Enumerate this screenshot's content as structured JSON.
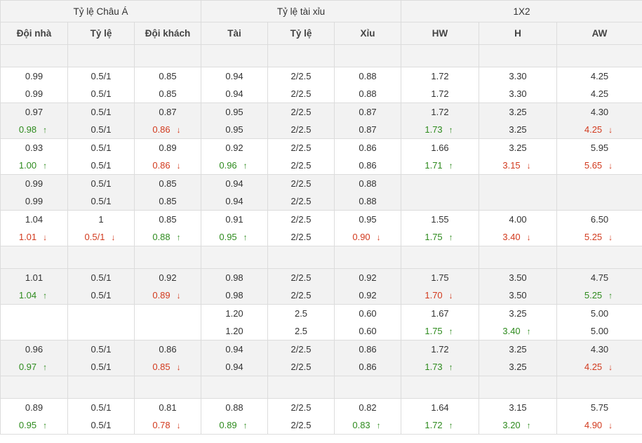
{
  "header": {
    "groups": [
      "Tỷ lệ Châu Á",
      "Tỷ lệ tài xỉu",
      "1X2"
    ],
    "columns": [
      "Đội nhà",
      "Tỷ lệ",
      "Đội khách",
      "Tài",
      "Tỷ lệ",
      "Xỉu",
      "HW",
      "H",
      "AW"
    ]
  },
  "colors": {
    "up": "#2e8b1e",
    "down": "#d23a1e",
    "header_bg": "#f3f3f3",
    "border": "#dcdcdc"
  },
  "rows": [
    {
      "empty": true
    },
    {
      "cells": [
        [
          {
            "t": "0.99"
          },
          {
            "t": "0.99"
          }
        ],
        [
          {
            "t": "0.5/1"
          },
          {
            "t": "0.5/1"
          }
        ],
        [
          {
            "t": "0.85"
          },
          {
            "t": "0.85"
          }
        ],
        [
          {
            "t": "0.94"
          },
          {
            "t": "0.94"
          }
        ],
        [
          {
            "t": "2/2.5"
          },
          {
            "t": "2/2.5"
          }
        ],
        [
          {
            "t": "0.88"
          },
          {
            "t": "0.88"
          }
        ],
        [
          {
            "t": "1.72"
          },
          {
            "t": "1.72"
          }
        ],
        [
          {
            "t": "3.30"
          },
          {
            "t": "3.30"
          }
        ],
        [
          {
            "t": "4.25"
          },
          {
            "t": "4.25"
          }
        ]
      ]
    },
    {
      "cells": [
        [
          {
            "t": "0.97"
          },
          {
            "t": "0.98",
            "d": "up"
          }
        ],
        [
          {
            "t": "0.5/1"
          },
          {
            "t": "0.5/1"
          }
        ],
        [
          {
            "t": "0.87"
          },
          {
            "t": "0.86",
            "d": "down"
          }
        ],
        [
          {
            "t": "0.95"
          },
          {
            "t": "0.95"
          }
        ],
        [
          {
            "t": "2/2.5"
          },
          {
            "t": "2/2.5"
          }
        ],
        [
          {
            "t": "0.87"
          },
          {
            "t": "0.87"
          }
        ],
        [
          {
            "t": "1.72"
          },
          {
            "t": "1.73",
            "d": "up"
          }
        ],
        [
          {
            "t": "3.25"
          },
          {
            "t": "3.25"
          }
        ],
        [
          {
            "t": "4.30"
          },
          {
            "t": "4.25",
            "d": "down"
          }
        ]
      ]
    },
    {
      "cells": [
        [
          {
            "t": "0.93"
          },
          {
            "t": "1.00",
            "d": "up"
          }
        ],
        [
          {
            "t": "0.5/1"
          },
          {
            "t": "0.5/1"
          }
        ],
        [
          {
            "t": "0.89"
          },
          {
            "t": "0.86",
            "d": "down"
          }
        ],
        [
          {
            "t": "0.92"
          },
          {
            "t": "0.96",
            "d": "up"
          }
        ],
        [
          {
            "t": "2/2.5"
          },
          {
            "t": "2/2.5"
          }
        ],
        [
          {
            "t": "0.86"
          },
          {
            "t": "0.86"
          }
        ],
        [
          {
            "t": "1.66"
          },
          {
            "t": "1.71",
            "d": "up"
          }
        ],
        [
          {
            "t": "3.25"
          },
          {
            "t": "3.15",
            "d": "down"
          }
        ],
        [
          {
            "t": "5.95"
          },
          {
            "t": "5.65",
            "d": "down"
          }
        ]
      ]
    },
    {
      "cells": [
        [
          {
            "t": "0.99"
          },
          {
            "t": "0.99"
          }
        ],
        [
          {
            "t": "0.5/1"
          },
          {
            "t": "0.5/1"
          }
        ],
        [
          {
            "t": "0.85"
          },
          {
            "t": "0.85"
          }
        ],
        [
          {
            "t": "0.94"
          },
          {
            "t": "0.94"
          }
        ],
        [
          {
            "t": "2/2.5"
          },
          {
            "t": "2/2.5"
          }
        ],
        [
          {
            "t": "0.88"
          },
          {
            "t": "0.88"
          }
        ],
        [],
        [],
        []
      ]
    },
    {
      "cells": [
        [
          {
            "t": "1.04"
          },
          {
            "t": "1.01",
            "d": "down"
          }
        ],
        [
          {
            "t": "1"
          },
          {
            "t": "0.5/1",
            "d": "down"
          }
        ],
        [
          {
            "t": "0.85"
          },
          {
            "t": "0.88",
            "d": "up"
          }
        ],
        [
          {
            "t": "0.91"
          },
          {
            "t": "0.95",
            "d": "up"
          }
        ],
        [
          {
            "t": "2/2.5"
          },
          {
            "t": "2/2.5"
          }
        ],
        [
          {
            "t": "0.95"
          },
          {
            "t": "0.90",
            "d": "down"
          }
        ],
        [
          {
            "t": "1.55"
          },
          {
            "t": "1.75",
            "d": "up"
          }
        ],
        [
          {
            "t": "4.00"
          },
          {
            "t": "3.40",
            "d": "down"
          }
        ],
        [
          {
            "t": "6.50"
          },
          {
            "t": "5.25",
            "d": "down"
          }
        ]
      ]
    },
    {
      "empty": true
    },
    {
      "cells": [
        [
          {
            "t": "1.01"
          },
          {
            "t": "1.04",
            "d": "up"
          }
        ],
        [
          {
            "t": "0.5/1"
          },
          {
            "t": "0.5/1"
          }
        ],
        [
          {
            "t": "0.92"
          },
          {
            "t": "0.89",
            "d": "down"
          }
        ],
        [
          {
            "t": "0.98"
          },
          {
            "t": "0.98"
          }
        ],
        [
          {
            "t": "2/2.5"
          },
          {
            "t": "2/2.5"
          }
        ],
        [
          {
            "t": "0.92"
          },
          {
            "t": "0.92"
          }
        ],
        [
          {
            "t": "1.75"
          },
          {
            "t": "1.70",
            "d": "down"
          }
        ],
        [
          {
            "t": "3.50"
          },
          {
            "t": "3.50"
          }
        ],
        [
          {
            "t": "4.75"
          },
          {
            "t": "5.25",
            "d": "up"
          }
        ]
      ]
    },
    {
      "cells": [
        [],
        [],
        [],
        [
          {
            "t": "1.20"
          },
          {
            "t": "1.20"
          }
        ],
        [
          {
            "t": "2.5"
          },
          {
            "t": "2.5"
          }
        ],
        [
          {
            "t": "0.60"
          },
          {
            "t": "0.60"
          }
        ],
        [
          {
            "t": "1.67"
          },
          {
            "t": "1.75",
            "d": "up"
          }
        ],
        [
          {
            "t": "3.25"
          },
          {
            "t": "3.40",
            "d": "up"
          }
        ],
        [
          {
            "t": "5.00"
          },
          {
            "t": "5.00"
          }
        ]
      ]
    },
    {
      "cells": [
        [
          {
            "t": "0.96"
          },
          {
            "t": "0.97",
            "d": "up"
          }
        ],
        [
          {
            "t": "0.5/1"
          },
          {
            "t": "0.5/1"
          }
        ],
        [
          {
            "t": "0.86"
          },
          {
            "t": "0.85",
            "d": "down"
          }
        ],
        [
          {
            "t": "0.94"
          },
          {
            "t": "0.94"
          }
        ],
        [
          {
            "t": "2/2.5"
          },
          {
            "t": "2/2.5"
          }
        ],
        [
          {
            "t": "0.86"
          },
          {
            "t": "0.86"
          }
        ],
        [
          {
            "t": "1.72"
          },
          {
            "t": "1.73",
            "d": "up"
          }
        ],
        [
          {
            "t": "3.25"
          },
          {
            "t": "3.25"
          }
        ],
        [
          {
            "t": "4.30"
          },
          {
            "t": "4.25",
            "d": "down"
          }
        ]
      ]
    },
    {
      "empty": true
    },
    {
      "cells": [
        [
          {
            "t": "0.89"
          },
          {
            "t": "0.95",
            "d": "up"
          }
        ],
        [
          {
            "t": "0.5/1"
          },
          {
            "t": "0.5/1"
          }
        ],
        [
          {
            "t": "0.81"
          },
          {
            "t": "0.78",
            "d": "down"
          }
        ],
        [
          {
            "t": "0.88"
          },
          {
            "t": "0.89",
            "d": "up"
          }
        ],
        [
          {
            "t": "2/2.5"
          },
          {
            "t": "2/2.5"
          }
        ],
        [
          {
            "t": "0.82"
          },
          {
            "t": "0.83",
            "d": "up"
          }
        ],
        [
          {
            "t": "1.64"
          },
          {
            "t": "1.72",
            "d": "up"
          }
        ],
        [
          {
            "t": "3.15"
          },
          {
            "t": "3.20",
            "d": "up"
          }
        ],
        [
          {
            "t": "5.75"
          },
          {
            "t": "4.90",
            "d": "down"
          }
        ]
      ]
    }
  ]
}
